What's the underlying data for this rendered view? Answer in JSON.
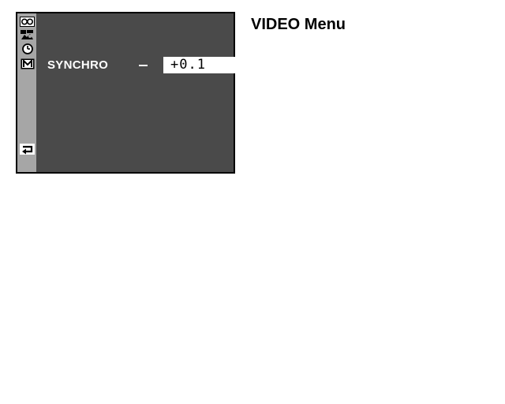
{
  "page": {
    "heading": "VIDEO Menu"
  },
  "screen": {
    "sidebar_icons": [
      {
        "name": "tape-icon"
      },
      {
        "name": "camera-settings-icon"
      },
      {
        "name": "clock-icon"
      },
      {
        "name": "manual-m-icon"
      },
      {
        "name": "return-icon"
      }
    ],
    "menu_item": {
      "label": "SYNCHRO",
      "value": "+0.1"
    }
  },
  "colors": {
    "screen_bg": "#4a4a4a",
    "sidebar_bg": "#a6a6a6",
    "highlight_bg": "#ffffff"
  }
}
